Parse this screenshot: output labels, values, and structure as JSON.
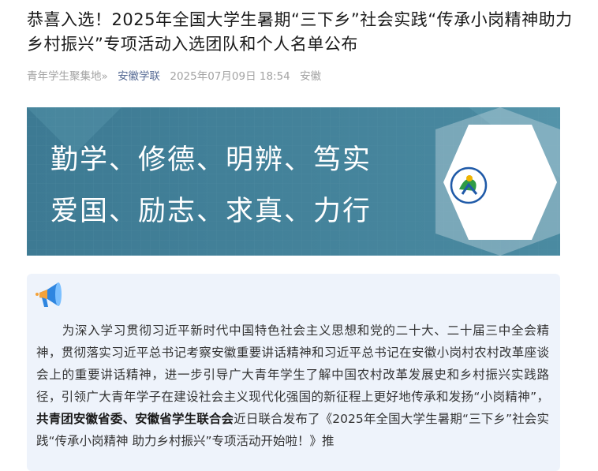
{
  "article": {
    "title": "恭喜入选！2025年全国大学生暑期“三下乡”社会实践“传承小岗精神助力乡村振兴”专项活动入选团队和个人名单公布",
    "meta": {
      "source": "青年学生聚集地»",
      "account": "安徽学联",
      "datetime": "2025年07月09日 18:54",
      "location": "安徽"
    }
  },
  "banner": {
    "line1": "勤学、修德、明辨、笃实",
    "line2": "爱国、励志、求真、力行",
    "background_color": "#3f7e96",
    "logo_icon": "youth-league-logo"
  },
  "intro": {
    "icon": "megaphone-icon",
    "text_before": "为深入学习贯彻习近平新时代中国特色社会主义思想和党的二十大、二十届三中全会精神，贯彻落实习近平总书记考察安徽重要讲话精神和习近平总书记在安徽小岗村农村改革座谈会上的重要讲话精神，进一步引导广大青年学生了解中国农村改革发展史和乡村振兴实践路径，引领广大青年学子在建设社会主义现代化强国的新征程上更好地传承和发扬“小岗精神”，",
    "text_bold": "共青团安徽省委、安徽省学生联合会",
    "text_after": "近日联合发布了《2025年全国大学生暑期“三下乡”社会实践“传承小岗精神 助力乡村振兴”专项活动开始啦！》推"
  }
}
